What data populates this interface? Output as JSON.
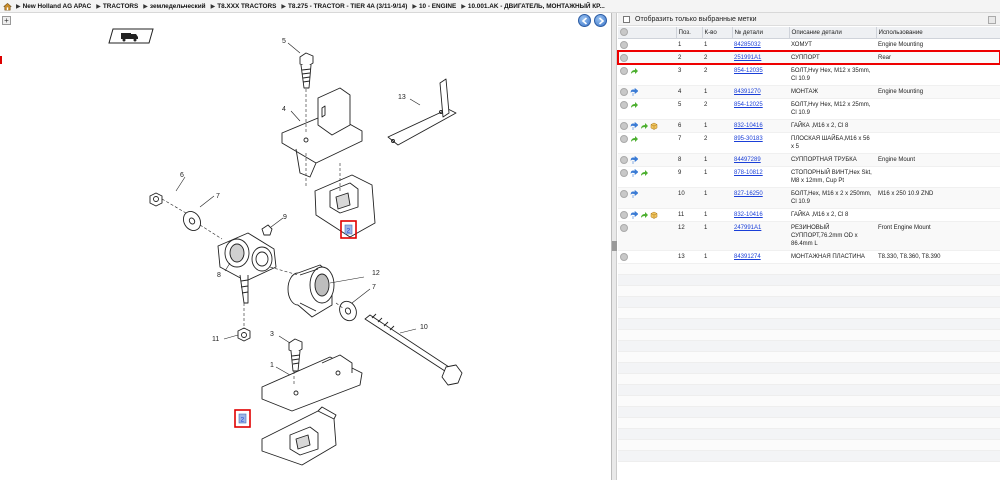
{
  "breadcrumb": {
    "items": [
      "New Holland AG APAC",
      "TRACTORS",
      "земледельческий",
      "T8.XXX TRACTORS",
      "T8.275 - TRACTOR - TIER 4A (3/11-9/14)",
      "10 - ENGINE",
      "10.001.AK - ДВИГАТЕЛЬ, МОНТАЖНЫЙ КР..."
    ]
  },
  "diagram": {
    "callouts": [
      "5",
      "4",
      "13",
      "6",
      "7",
      "9",
      "8",
      "12",
      "7",
      "11",
      "3",
      "10",
      "1",
      "2",
      "2"
    ]
  },
  "filter": {
    "label": "Отобразить только выбранные метки"
  },
  "table": {
    "headers": [
      "",
      "Поз.",
      "К-во",
      "№ детали",
      "Описание детали",
      "Использование"
    ],
    "rows": [
      {
        "icons": [],
        "pos": "1",
        "qty": "1",
        "part": "84285032",
        "desc": "ХОМУТ",
        "usage": "Engine Mounting"
      },
      {
        "icons": [],
        "pos": "2",
        "qty": "2",
        "part": "251991A1",
        "desc": "СУППОРТ",
        "usage": "Rear"
      },
      {
        "icons": [
          "green-arrow"
        ],
        "pos": "3",
        "qty": "2",
        "part": "854-12035",
        "desc": "БОЛТ,Hvy Hex, M12 x 35mm, Cl 10.9",
        "usage": ""
      },
      {
        "icons": [
          "blue-arrow"
        ],
        "pos": "4",
        "qty": "1",
        "part": "84391270",
        "desc": "МОНТАЖ",
        "usage": "Engine Mounting"
      },
      {
        "icons": [
          "green-arrow"
        ],
        "pos": "5",
        "qty": "2",
        "part": "854-12025",
        "desc": "БОЛТ,Hvy Hex, M12 x 25mm, Cl 10.9",
        "usage": ""
      },
      {
        "icons": [
          "blue-arrow",
          "green-arrow",
          "box"
        ],
        "pos": "6",
        "qty": "1",
        "part": "832-10416",
        "desc": "ГАЙКА ,M16 x 2, Cl 8",
        "usage": ""
      },
      {
        "icons": [
          "green-arrow"
        ],
        "pos": "7",
        "qty": "2",
        "part": "895-30183",
        "desc": "ПЛОСКАЯ ШАЙБА,M16 x 56 x 5",
        "usage": ""
      },
      {
        "icons": [
          "blue-arrow"
        ],
        "pos": "8",
        "qty": "1",
        "part": "84497289",
        "desc": "СУППОРТНАЯ ТРУБКА",
        "usage": "Engine Mount"
      },
      {
        "icons": [
          "blue-arrow",
          "green-arrow"
        ],
        "pos": "9",
        "qty": "1",
        "part": "878-10812",
        "desc": "СТОПОРНЫЙ ВИНТ,Hex Skt, M8 x 12mm, Cup Pt",
        "usage": ""
      },
      {
        "icons": [
          "blue-arrow"
        ],
        "pos": "10",
        "qty": "1",
        "part": "827-16250",
        "desc": "БОЛТ,Hex, M16 x 2 x 250mm, Cl 10.9",
        "usage": "M16 x 250 10.9 ZND"
      },
      {
        "icons": [
          "blue-arrow",
          "green-arrow",
          "box"
        ],
        "pos": "11",
        "qty": "1",
        "part": "832-10416",
        "desc": "ГАЙКА ,M16 x 2, Cl 8",
        "usage": ""
      },
      {
        "icons": [],
        "pos": "12",
        "qty": "1",
        "part": "247991A1",
        "desc": "РЕЗИНОВЫЙ СУППОРТ,76.2mm OD x 86.4mm L",
        "usage": "Front Engine Mount"
      },
      {
        "icons": [],
        "pos": "13",
        "qty": "1",
        "part": "84391274",
        "desc": "МОНТАЖНАЯ ПЛАСТИНА",
        "usage": "T8.330, T8.360, T8.390"
      }
    ]
  },
  "colors": {
    "link": "#1a3fd8",
    "selection": "#c9c9c9",
    "highlight": "#e00000",
    "green_icon": "#4caf2f",
    "blue_icon": "#3a7bd5"
  }
}
